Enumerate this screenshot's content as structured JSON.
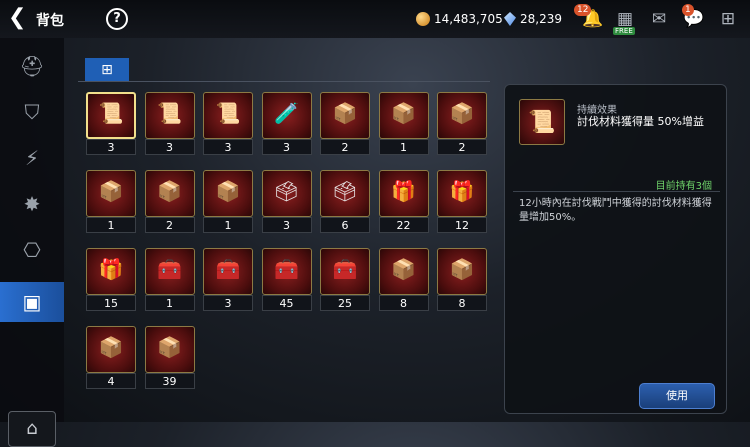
{
  "header": {
    "back_icon": "back-arrow-icon",
    "title": "背包",
    "help": "?",
    "gold": "14,483,705",
    "gems": "28,239",
    "notif_count": "12",
    "free_label": "FREE",
    "chat_badge": "1"
  },
  "sidebar": {
    "items": [
      "helmet-icon",
      "shield-icon",
      "lightning-icon",
      "badge-icon",
      "scroll-icon",
      "chest-icon"
    ],
    "bottom": "bag-icon"
  },
  "tab": {
    "icon": "grid-icon"
  },
  "items": [
    {
      "icon": "📜",
      "count": "3"
    },
    {
      "icon": "📜",
      "count": "3"
    },
    {
      "icon": "📜",
      "count": "3"
    },
    {
      "icon": "🧪",
      "count": "3"
    },
    {
      "icon": "📦",
      "count": "2"
    },
    {
      "icon": "📦",
      "count": "1"
    },
    {
      "icon": "📦",
      "count": "2"
    },
    {
      "icon": "📦",
      "count": "1"
    },
    {
      "icon": "📦",
      "count": "2"
    },
    {
      "icon": "📦",
      "count": "1"
    },
    {
      "icon": "🗳",
      "count": "3"
    },
    {
      "icon": "🗳",
      "count": "6"
    },
    {
      "icon": "🎁",
      "count": "22"
    },
    {
      "icon": "🎁",
      "count": "12"
    },
    {
      "icon": "🎁",
      "count": "15"
    },
    {
      "icon": "🧰",
      "count": "1"
    },
    {
      "icon": "🧰",
      "count": "3"
    },
    {
      "icon": "🧰",
      "count": "45"
    },
    {
      "icon": "🧰",
      "count": "25"
    },
    {
      "icon": "📦",
      "count": "8"
    },
    {
      "icon": "📦",
      "count": "8"
    },
    {
      "icon": "📦",
      "count": "4"
    },
    {
      "icon": "📦",
      "count": "39"
    }
  ],
  "detail": {
    "tag": "持續效果",
    "name": "討伐材料獲得量 50%增益",
    "owned": "目前持有3個",
    "description": "12小時內在討伐戰鬥中獲得的討伐材料獲得量增加50%。",
    "use_label": "使用"
  }
}
